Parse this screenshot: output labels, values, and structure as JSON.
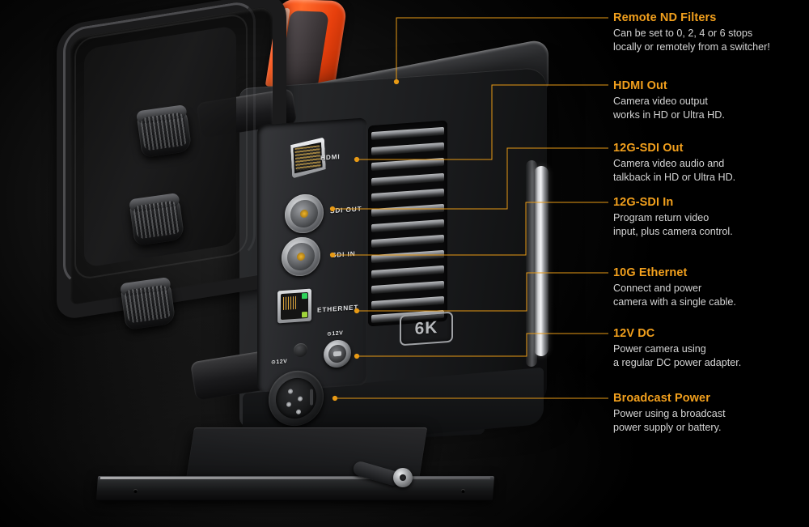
{
  "diagram": {
    "subject": "Blackmagic camera rear connections diagram",
    "accent_color": "#f2a01d",
    "body_text_color": "#d4d4d4",
    "background_color": "#000000",
    "handle_accent_color": "#ff4a15"
  },
  "callouts": [
    {
      "id": "remote-nd-filters",
      "title": "Remote ND Filters",
      "body_line1": "Can be set to 0, 2, 4 or 6 stops",
      "body_line2": "locally or remotely from a switcher!"
    },
    {
      "id": "hdmi-out",
      "title": "HDMI Out",
      "body_line1": "Camera video output",
      "body_line2": "works in HD or Ultra HD."
    },
    {
      "id": "12g-sdi-out",
      "title": "12G-SDI Out",
      "body_line1": "Camera video audio and",
      "body_line2": "talkback in HD or Ultra HD."
    },
    {
      "id": "12g-sdi-in",
      "title": "12G-SDI In",
      "body_line1": "Program return video",
      "body_line2": "input, plus camera control."
    },
    {
      "id": "10g-ethernet",
      "title": "10G Ethernet",
      "body_line1": "Connect and power",
      "body_line2": "camera with a single cable."
    },
    {
      "id": "12v-dc",
      "title": "12V DC",
      "body_line1": "Power camera using",
      "body_line2": "a regular DC power adapter."
    },
    {
      "id": "broadcast-power",
      "title": "Broadcast Power",
      "body_line1": "Power using a broadcast",
      "body_line2": "power supply or battery."
    }
  ],
  "port_labels": {
    "hdmi": "HDMI",
    "sdi_out": "SDI OUT",
    "sdi_in": "SDI IN",
    "ethernet": "ETHERNET",
    "dc_12v_small": "12V",
    "dc_12v_xlr": "12V"
  },
  "badge": {
    "resolution": "6K"
  }
}
